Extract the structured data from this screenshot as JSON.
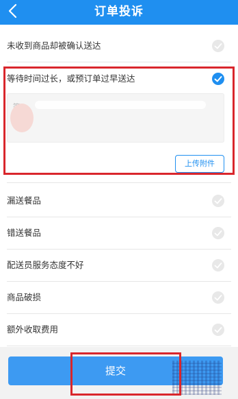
{
  "header": {
    "title": "订单投诉"
  },
  "reasons": [
    {
      "label": "未收到商品却被确认送达",
      "selected": false
    },
    {
      "label": "等待时间过长，或预订单过早送达",
      "selected": true
    },
    {
      "label": "漏送餐品",
      "selected": false
    },
    {
      "label": "错送餐品",
      "selected": false
    },
    {
      "label": "配送员服务态度不好",
      "selected": false
    },
    {
      "label": "商品破损",
      "selected": false
    },
    {
      "label": "额外收取费用",
      "selected": false
    }
  ],
  "note": {
    "text": "等"
  },
  "upload_label": "上传附件",
  "submit_label": "提交",
  "colors": {
    "primary": "#1f8ff0",
    "highlight": "#d9262c"
  }
}
